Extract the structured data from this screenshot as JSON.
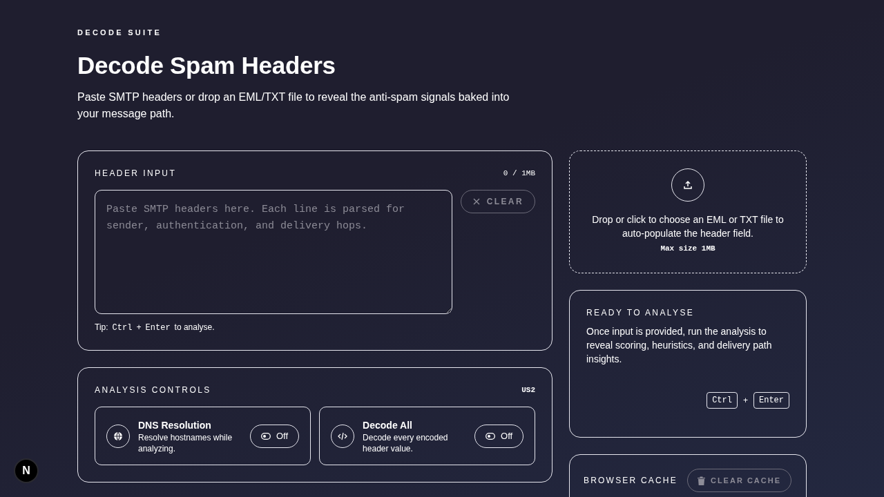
{
  "brand": "DECODE SUITE",
  "title": "Decode Spam Headers",
  "subtitle": "Paste SMTP headers or drop an EML/TXT file to reveal the anti-spam signals baked into your message path.",
  "header_input": {
    "title": "HEADER INPUT",
    "size": "0 / 1MB",
    "placeholder": "Paste SMTP headers here. Each line is parsed for sender, authentication, and delivery hops.",
    "clear": {
      "label": "CLEAR",
      "disabled": true
    },
    "tip": {
      "prefix": "Tip:",
      "keys": [
        "Ctrl",
        "Enter"
      ],
      "joiner": "+",
      "suffix": "to analyse."
    }
  },
  "analysis_controls": {
    "title": "ANALYSIS CONTROLS",
    "badge": "US2",
    "toggles": [
      {
        "kind": "globe",
        "title": "DNS Resolution",
        "description": "Resolve hostnames while analyzing.",
        "on": false,
        "state_label": "Off"
      },
      {
        "kind": "code",
        "title": "Decode All",
        "description": "Decode every encoded header value.",
        "on": false,
        "state_label": "Off"
      }
    ]
  },
  "dropzone": {
    "text": "Drop or click to choose an EML or TXT file to auto-populate the header field.",
    "max_size": "Max size 1MB"
  },
  "ready": {
    "title": "READY TO ANALYSE",
    "text": "Once input is provided, run the analysis to reveal scoring, heuristics, and delivery path insights.",
    "keys": [
      "Ctrl",
      "Enter"
    ],
    "joiner": "+"
  },
  "browser_cache": {
    "title": "BROWSER CACHE",
    "clear": {
      "label": "CLEAR CACHE",
      "disabled": true
    }
  },
  "dev_badge": "N"
}
